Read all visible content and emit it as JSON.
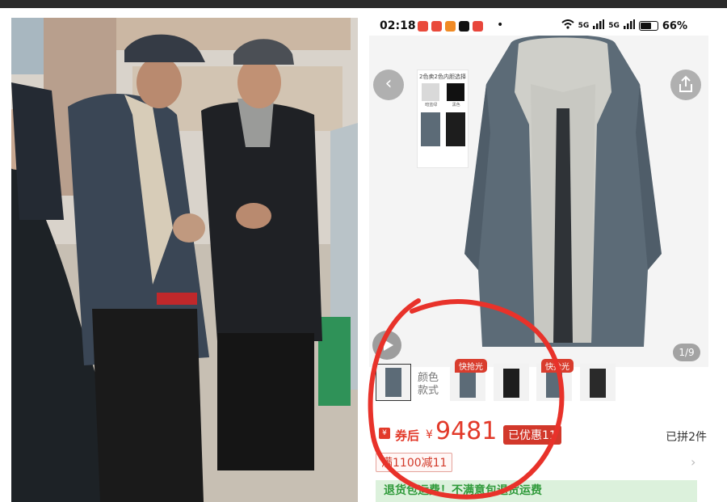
{
  "status_bar": {
    "time": "02:18",
    "dot": "•",
    "network": "5G",
    "battery": "66%"
  },
  "gallery": {
    "back_icon": "chevron-left-icon",
    "share_icon": "share-icon",
    "play_icon": "play-icon",
    "page_indicator": "1/9",
    "variant_card_title": "2色卖2色内胆选择",
    "variant_labels": [
      "暗蓝绿",
      "黑色"
    ]
  },
  "swatches": {
    "label": "颜色款式",
    "hot_tag": "快抢光",
    "count": 6
  },
  "price": {
    "yen_badge": "¥",
    "after_coupon_label": "券后",
    "currency": "¥",
    "amount": "9481",
    "discount": "已优惠11",
    "sold": "已拼2件"
  },
  "coupon": "满1100减11",
  "green_bar": "退货包运费！不满意包退货运费",
  "colors": {
    "accent_red": "#e23a2a",
    "coat": "#5c6b77",
    "lining": "#cfcfc9",
    "green": "#2f9a3a"
  }
}
